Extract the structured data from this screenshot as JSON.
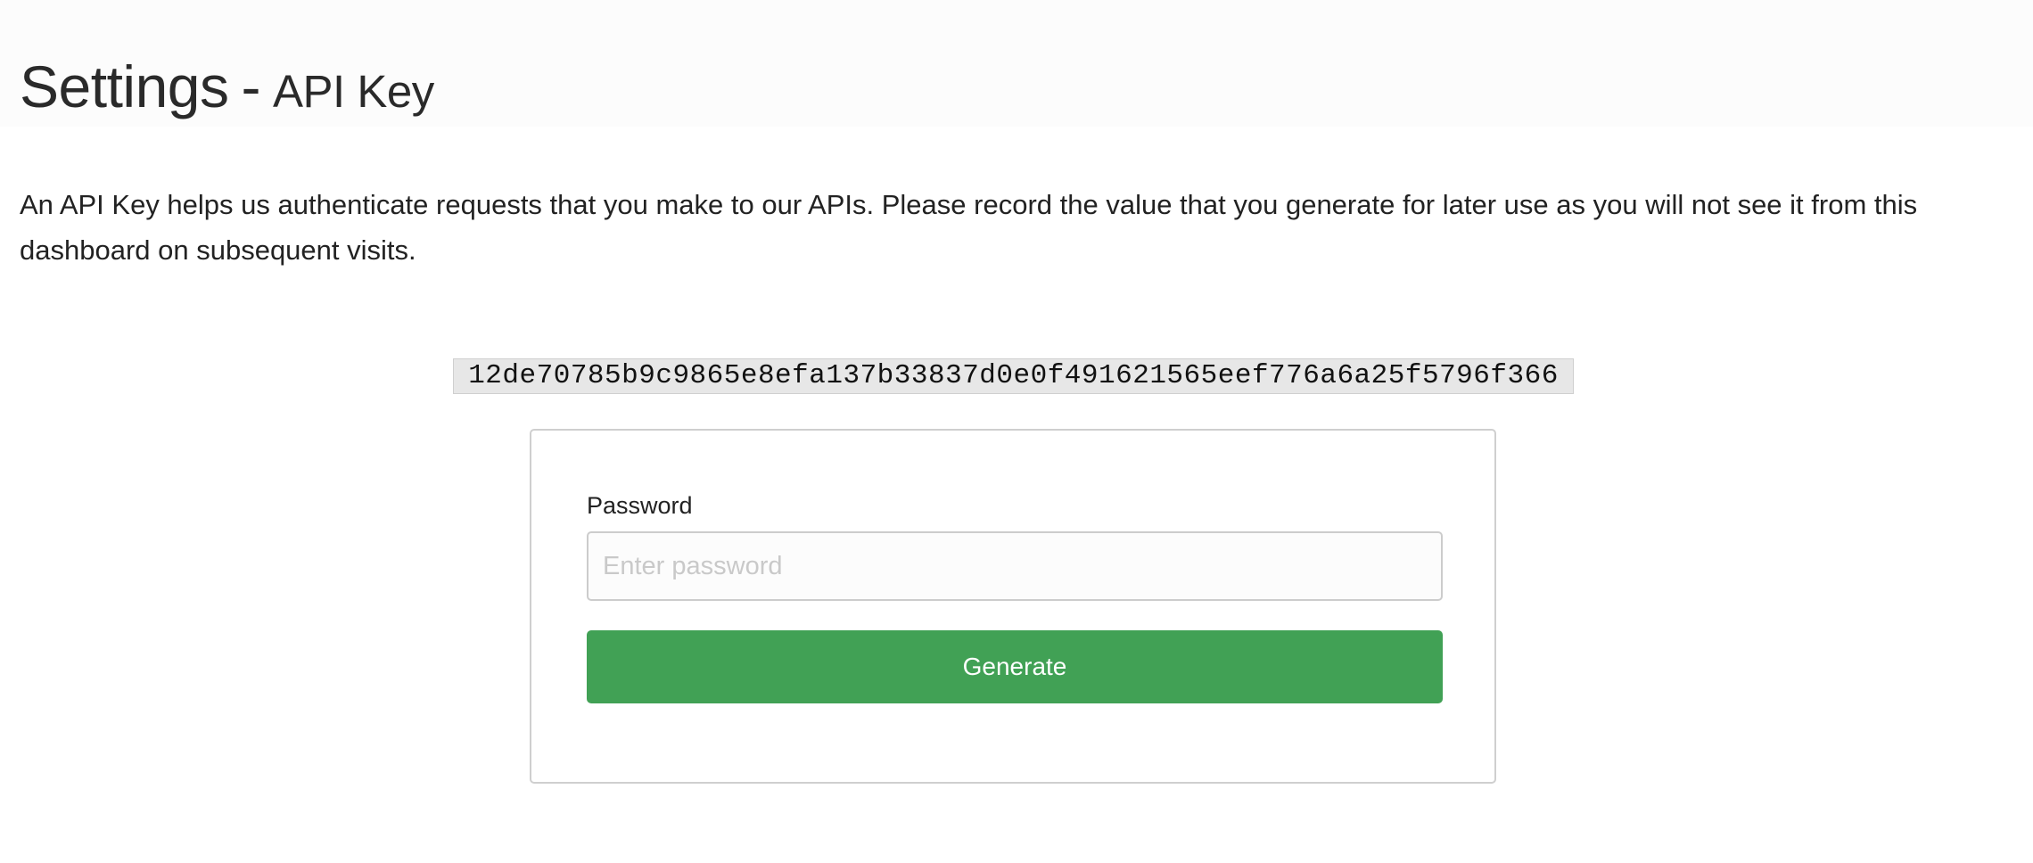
{
  "page": {
    "title": "Settings",
    "separator": "-",
    "subtitle": "API Key"
  },
  "description": "An API Key helps us authenticate requests that you make to our APIs. Please record the value that you generate for later use as you will not see it from this dashboard on subsequent visits.",
  "api_key": {
    "value": "12de70785b9c9865e8efa137b33837d0e0f491621565eef776a6a25f5796f366"
  },
  "form": {
    "password_label": "Password",
    "password_placeholder": "Enter password",
    "password_value": "",
    "generate_label": "Generate"
  },
  "colors": {
    "primary_button": "#41a155",
    "key_background": "#e7e7e7",
    "card_border": "#cfcfcf"
  }
}
